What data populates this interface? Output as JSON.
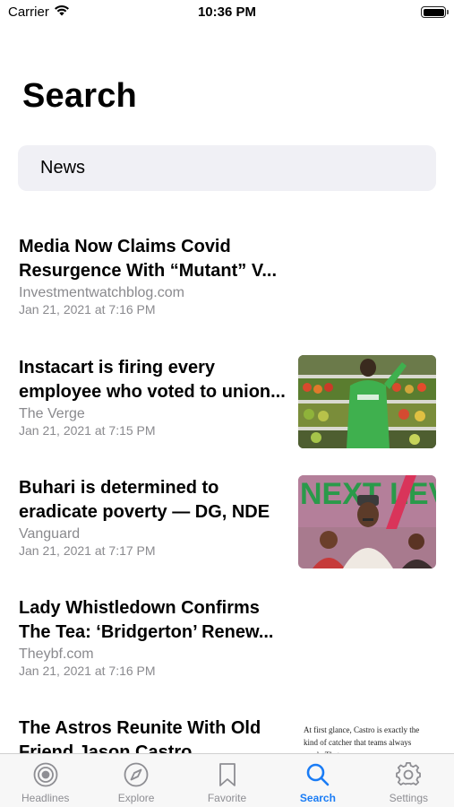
{
  "status_bar": {
    "carrier": "Carrier",
    "time": "10:36 PM"
  },
  "page_title": "Search",
  "search": {
    "value": "News"
  },
  "articles": [
    {
      "title": "Media Now Claims Covid Resurgence With “Mutant” V...",
      "source": "Investmentwatchblog.com",
      "date": "Jan 21, 2021 at 7:16 PM"
    },
    {
      "title": "Instacart is firing every employee who voted to union...",
      "source": "The Verge",
      "date": "Jan 21, 2021 at 7:15 PM"
    },
    {
      "title": "Buhari is determined to eradicate poverty — DG, NDE",
      "source": "Vanguard",
      "date": "Jan 21, 2021 at 7:17 PM"
    },
    {
      "title": "Lady Whistledown Confirms The Tea: ‘Bridgerton’ Renew...",
      "source": "Theybf.com",
      "date": "Jan 21, 2021 at 7:16 PM"
    },
    {
      "title": "The Astros Reunite With Old Friend Jason Castro",
      "source": "",
      "date": ""
    }
  ],
  "thumb_texts": {
    "nde_banner": "NEXT LEVEL",
    "castro_quote": "At first glance, Castro is exactly the kind of catcher that teams always need...That"
  },
  "tabs": [
    {
      "label": "Headlines",
      "icon": "headlines-icon",
      "active": false
    },
    {
      "label": "Explore",
      "icon": "compass-icon",
      "active": false
    },
    {
      "label": "Favorite",
      "icon": "bookmark-icon",
      "active": false
    },
    {
      "label": "Search",
      "icon": "search-icon",
      "active": true
    },
    {
      "label": "Settings",
      "icon": "gear-icon",
      "active": false
    }
  ],
  "colors": {
    "accent": "#1a7cf5",
    "inactive": "#8e8e93",
    "search_bg": "#f0f0f5",
    "secondary_text": "#8a8a8e"
  }
}
